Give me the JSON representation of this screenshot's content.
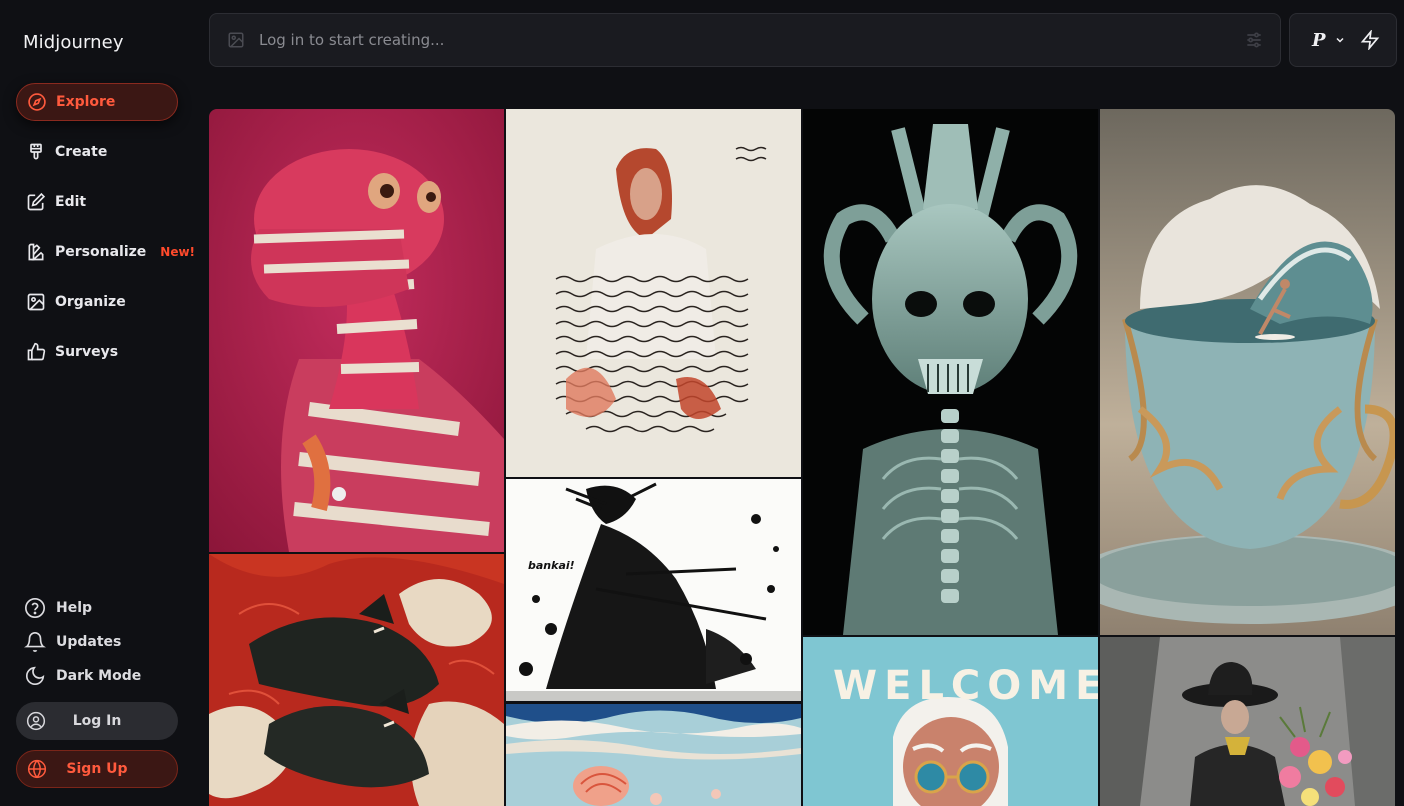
{
  "app": {
    "brand": "Midjourney"
  },
  "nav": {
    "items": [
      {
        "label": "Explore",
        "icon": "compass-icon",
        "active": true
      },
      {
        "label": "Create",
        "icon": "paintbrush-icon"
      },
      {
        "label": "Edit",
        "icon": "edit-icon"
      },
      {
        "label": "Personalize",
        "icon": "personalize-icon",
        "badge": "New!"
      },
      {
        "label": "Organize",
        "icon": "image-icon"
      },
      {
        "label": "Surveys",
        "icon": "thumbs-up-icon"
      }
    ]
  },
  "bottom": {
    "help": "Help",
    "updates": "Updates",
    "dark_mode": "Dark Mode",
    "login": "Log In",
    "signup": "Sign Up"
  },
  "prompt": {
    "placeholder": "Log in to start creating..."
  },
  "mode": {
    "label": "P"
  },
  "gallery": {
    "images": [
      {
        "name": "knitted-dinosaur-image"
      },
      {
        "name": "wavy-line-woman-image"
      },
      {
        "name": "xray-alien-image"
      },
      {
        "name": "teacup-surfer-image"
      },
      {
        "name": "red-wolves-image"
      },
      {
        "name": "ink-samurai-image",
        "text": "bankai!"
      },
      {
        "name": "seashell-waves-image"
      },
      {
        "name": "welcome-poster-image",
        "text": "WELCOME"
      },
      {
        "name": "hat-woman-flowers-image"
      }
    ]
  },
  "colors": {
    "accent": "#ff5a3d",
    "background": "#0f1014"
  }
}
